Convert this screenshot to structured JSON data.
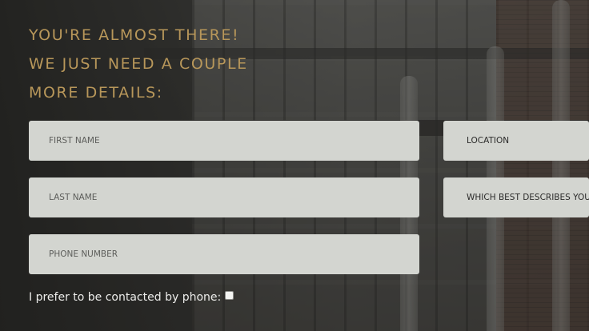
{
  "heading": {
    "line1": "YOU'RE ALMOST THERE!",
    "line2": "WE JUST NEED A COUPLE",
    "line3": "MORE DETAILS:"
  },
  "form": {
    "first_name_placeholder": "FIRST NAME",
    "last_name_placeholder": "LAST NAME",
    "phone_placeholder": "PHONE NUMBER",
    "location_placeholder": "LOCATION",
    "describes_placeholder": "WHICH BEST DESCRIBES YOU?",
    "phone_pref_label": "I prefer to be contacted by phone:",
    "phone_pref_checked": false
  },
  "colors": {
    "heading": "#b8975a",
    "field_bg": "#d3d5d0",
    "label_text": "#ececea"
  }
}
